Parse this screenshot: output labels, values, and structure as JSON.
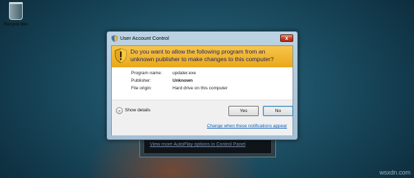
{
  "desktop": {
    "recycle_bin_label": "Recycle Bin",
    "background_window_link": "View more AutoPlay options in Control Panel",
    "watermark": "wsxdn.com"
  },
  "dialog": {
    "title": "User Account Control",
    "close_label": "x",
    "question": "Do you want to allow the following program from an unknown publisher to make changes to this computer?",
    "details": [
      {
        "key": "Program name:",
        "value": "updater.exe"
      },
      {
        "key": "Publisher:",
        "value": "Unknown"
      },
      {
        "key": "File origin:",
        "value": "Hard drive on this computer"
      }
    ],
    "show_details": "Show details",
    "yes_label": "Yes",
    "no_label": "No",
    "change_link": "Change when these notifications appear"
  },
  "colors": {
    "banner": "#f0b52c",
    "question_text": "#1a1f70",
    "link": "#1060b8"
  },
  "icons": {
    "title_icon": "uac-shield-icon",
    "banner_icon": "warning-shield-icon",
    "details_toggle": "chevron-down-icon",
    "recycle_bin": "recycle-bin-icon"
  }
}
